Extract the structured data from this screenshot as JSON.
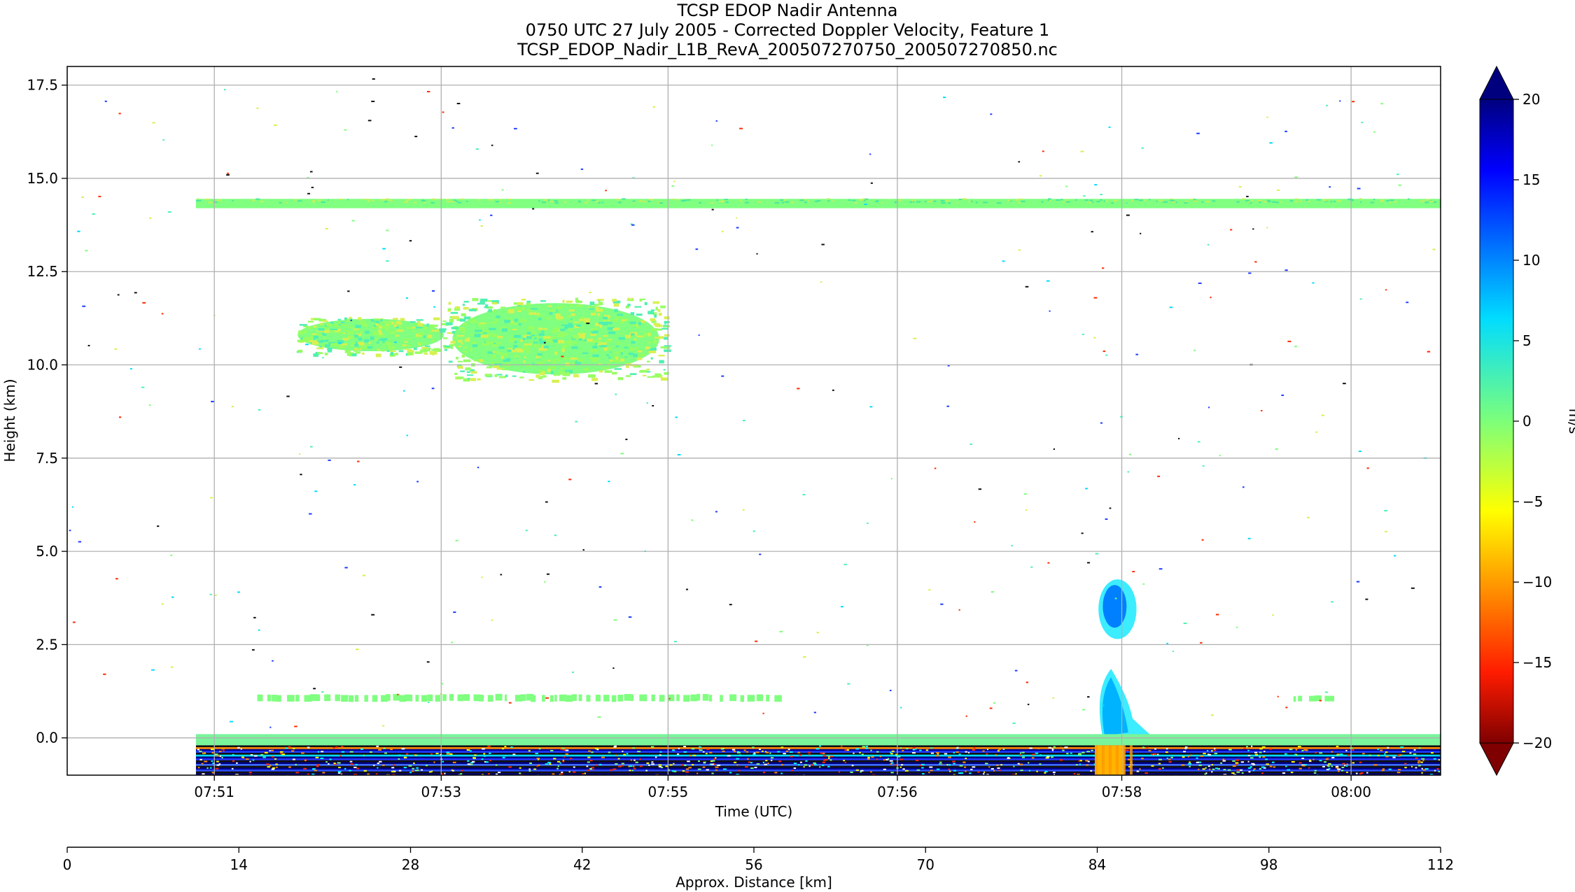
{
  "chart_data": {
    "type": "heatmap",
    "title": [
      "TCSP EDOP Nadir Antenna",
      "0750 UTC 27 July 2005 - Corrected Doppler Velocity, Feature 1",
      "TCSP_EDOP_Nadir_L1B_RevA_200507270750_200507270850.nc"
    ],
    "xlabel": "Time (UTC)",
    "ylabel": "Height (km)",
    "x2label": "Approx. Distance [km]",
    "colorbar_label": "m/s",
    "ylim": [
      -1.0,
      18.0
    ],
    "distance_lim": [
      0,
      112
    ],
    "clim": [
      -20,
      20
    ],
    "colorbar_extend": "both",
    "colormap": "jet_r",
    "grid": true,
    "x_ticks": [
      {
        "label": "07:51",
        "dist": 12
      },
      {
        "label": "07:53",
        "dist": 30.5
      },
      {
        "label": "07:55",
        "dist": 49
      },
      {
        "label": "07:56",
        "dist": 67.7
      },
      {
        "label": "07:58",
        "dist": 86
      },
      {
        "label": "08:00",
        "dist": 104.7
      }
    ],
    "y_ticks": [
      {
        "label": "0.0",
        "value": 0
      },
      {
        "label": "2.5",
        "value": 2.5
      },
      {
        "label": "5.0",
        "value": 5
      },
      {
        "label": "7.5",
        "value": 7.5
      },
      {
        "label": "10.0",
        "value": 10
      },
      {
        "label": "12.5",
        "value": 12.5
      },
      {
        "label": "15.0",
        "value": 15
      },
      {
        "label": "17.5",
        "value": 17.5
      }
    ],
    "distance_ticks": [
      {
        "label": "0",
        "value": 0
      },
      {
        "label": "14",
        "value": 14
      },
      {
        "label": "28",
        "value": 28
      },
      {
        "label": "42",
        "value": 42
      },
      {
        "label": "56",
        "value": 56
      },
      {
        "label": "70",
        "value": 70
      },
      {
        "label": "84",
        "value": 84
      },
      {
        "label": "98",
        "value": 98
      },
      {
        "label": "112",
        "value": 112
      }
    ],
    "colorbar_ticks": [
      {
        "label": "20",
        "value": 20
      },
      {
        "label": "15",
        "value": 15
      },
      {
        "label": "10",
        "value": 10
      },
      {
        "label": "5",
        "value": 5
      },
      {
        "label": "0",
        "value": 0
      },
      {
        "label": "−5",
        "value": -5
      },
      {
        "label": "−10",
        "value": -10
      },
      {
        "label": "−15",
        "value": -15
      },
      {
        "label": "−20",
        "value": -20
      }
    ],
    "features": [
      {
        "name": "data-start",
        "dist_start": 10.5,
        "dist_end": 112
      },
      {
        "name": "layer-14km",
        "dist_start": 10.5,
        "dist_end": 112,
        "h_bottom": 14.2,
        "h_top": 14.45,
        "velocity": 0
      },
      {
        "name": "cirrus-left",
        "dist_start": 18.5,
        "dist_end": 31,
        "h_bottom": 10.3,
        "h_top": 11.3,
        "velocity": 0
      },
      {
        "name": "cirrus-right",
        "dist_start": 31,
        "dist_end": 48.7,
        "h_bottom": 9.6,
        "h_top": 11.8,
        "velocity": 0
      },
      {
        "name": "cell-mid",
        "dist_start": 84.1,
        "dist_end": 87.2,
        "h_bottom": 2.65,
        "h_top": 4.25,
        "velocity": 10
      },
      {
        "name": "cell-low",
        "dist_start": 83.9,
        "dist_end": 87.4,
        "h_bottom": 0.05,
        "h_top": 1.85,
        "velocity": 8
      },
      {
        "name": "thin-layer-1km",
        "dist_start": 15.5,
        "dist_end": 58,
        "h_bottom": 1.0,
        "h_top": 1.18,
        "velocity": 0
      },
      {
        "name": "thin-layer-right",
        "dist_start": 100,
        "dist_end": 103.5,
        "h_bottom": 1.0,
        "h_top": 1.15,
        "velocity": 0
      },
      {
        "name": "surface-band",
        "dist_start": 10.5,
        "dist_end": 112,
        "h_bottom": -1.0,
        "h_top": 0.1
      },
      {
        "name": "surface-rain",
        "dist_start": 83.8,
        "dist_end": 86.2,
        "h_bottom": -1.0,
        "h_top": -0.2,
        "velocity": -8
      }
    ]
  }
}
